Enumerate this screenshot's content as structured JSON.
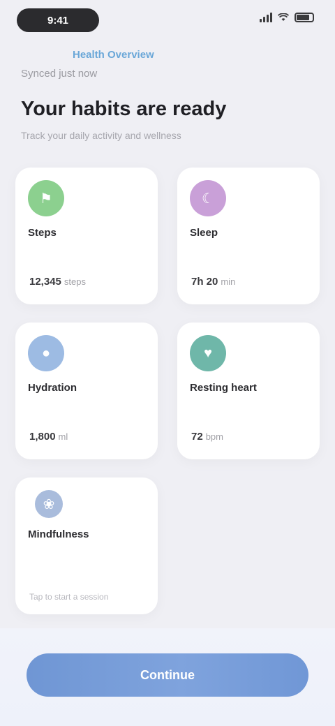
{
  "status_bar": {
    "time": "9:41",
    "center_label": "",
    "icons": [
      "signal-icon",
      "wifi-icon",
      "battery-icon"
    ]
  },
  "header": {
    "eyebrow": "Health Overview",
    "subtitle": "Synced just now",
    "title": "Your habits are ready",
    "description": "Track your daily activity and wellness"
  },
  "cards": [
    {
      "name": "steps",
      "title": "Steps",
      "value": "12,345",
      "unit": "steps",
      "color": "#8cd08f",
      "icon": "walk-icon",
      "glyph": "⚑"
    },
    {
      "name": "sleep",
      "title": "Sleep",
      "value": "7h 20",
      "unit": "min",
      "color": "#c9a0d8",
      "icon": "moon-icon",
      "glyph": "☾"
    },
    {
      "name": "hydration",
      "title": "Hydration",
      "value": "1,800",
      "unit": "ml",
      "color": "#9dbbe3",
      "icon": "drop-icon",
      "glyph": "●"
    },
    {
      "name": "heart-rate",
      "title": "Resting heart",
      "value": "72",
      "unit": "bpm",
      "color": "#6fb7a9",
      "icon": "heart-icon",
      "glyph": "♥"
    },
    {
      "name": "mindfulness",
      "title": "Mindfulness",
      "value": "",
      "unit": "",
      "footer": "Tap to start a session",
      "color": "#a9bcdc",
      "icon": "lotus-icon",
      "glyph": "❀"
    }
  ],
  "primary_button": {
    "label": "Continue"
  },
  "colors": {
    "background": "#efeff4",
    "accent": "#7097d6"
  }
}
